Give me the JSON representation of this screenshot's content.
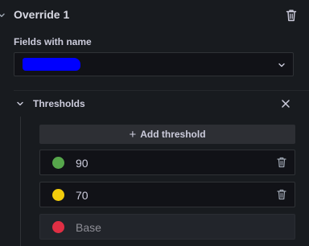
{
  "override": {
    "title": "Override 1",
    "matcher_label": "Fields with name",
    "matcher_value_redacted": true
  },
  "thresholds": {
    "title": "Thresholds",
    "add_label": "Add threshold",
    "items": [
      {
        "value": "90",
        "color": "#56a64b",
        "deletable": true
      },
      {
        "value": "70",
        "color": "#f2cc0c",
        "deletable": true
      },
      {
        "value": "Base",
        "color": "#e02f44",
        "deletable": false
      }
    ]
  },
  "icons": {
    "collapse": "chevron-down-icon",
    "delete": "trash-icon",
    "remove": "close-icon",
    "add": "plus-icon"
  }
}
